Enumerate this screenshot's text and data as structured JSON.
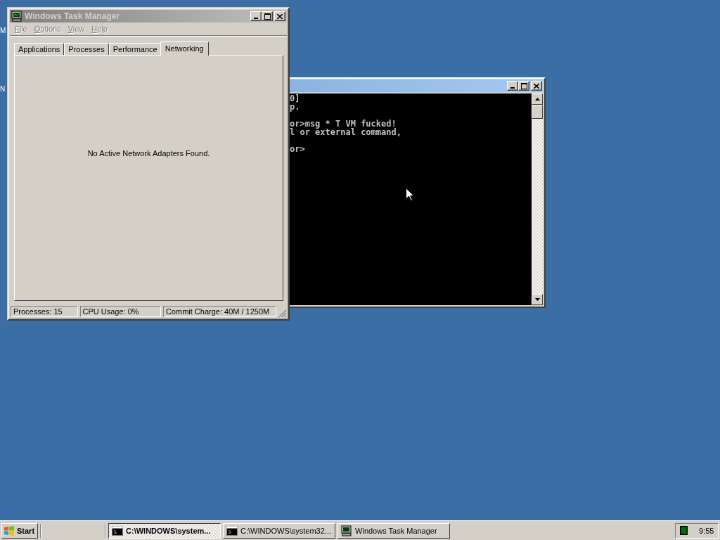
{
  "desktop_icons": [
    {
      "label": "M"
    },
    {
      "label": "N"
    }
  ],
  "console_window": {
    "blocks": [
      [
        "0]",
        "p."
      ],
      [
        "or>msg * T VM fucked!",
        "l or external command,"
      ],
      [
        "or>"
      ]
    ]
  },
  "task_manager": {
    "title": "Windows Task Manager",
    "menu": [
      {
        "label": "File",
        "disabled": true
      },
      {
        "label": "Options",
        "disabled": true
      },
      {
        "label": "View",
        "disabled": true
      },
      {
        "label": "Help",
        "disabled": true
      }
    ],
    "tabs": [
      {
        "label": "Applications",
        "selected": false
      },
      {
        "label": "Processes",
        "selected": false
      },
      {
        "label": "Performance",
        "selected": false
      },
      {
        "label": "Networking",
        "selected": true
      }
    ],
    "message": "No Active Network Adapters Found.",
    "status_bar": [
      "Processes: 15",
      "CPU Usage: 0%",
      "Commit Charge: 40M / 1250M"
    ]
  },
  "taskbar": {
    "start": "Start",
    "buttons": [
      {
        "label": "C:\\WINDOWS\\system...",
        "kind": "console",
        "selected": true
      },
      {
        "label": "C:\\WINDOWS\\system32...",
        "kind": "console",
        "selected": false
      },
      {
        "label": "Windows Task Manager",
        "kind": "taskmgr",
        "selected": false
      }
    ],
    "clock": "9:55"
  }
}
